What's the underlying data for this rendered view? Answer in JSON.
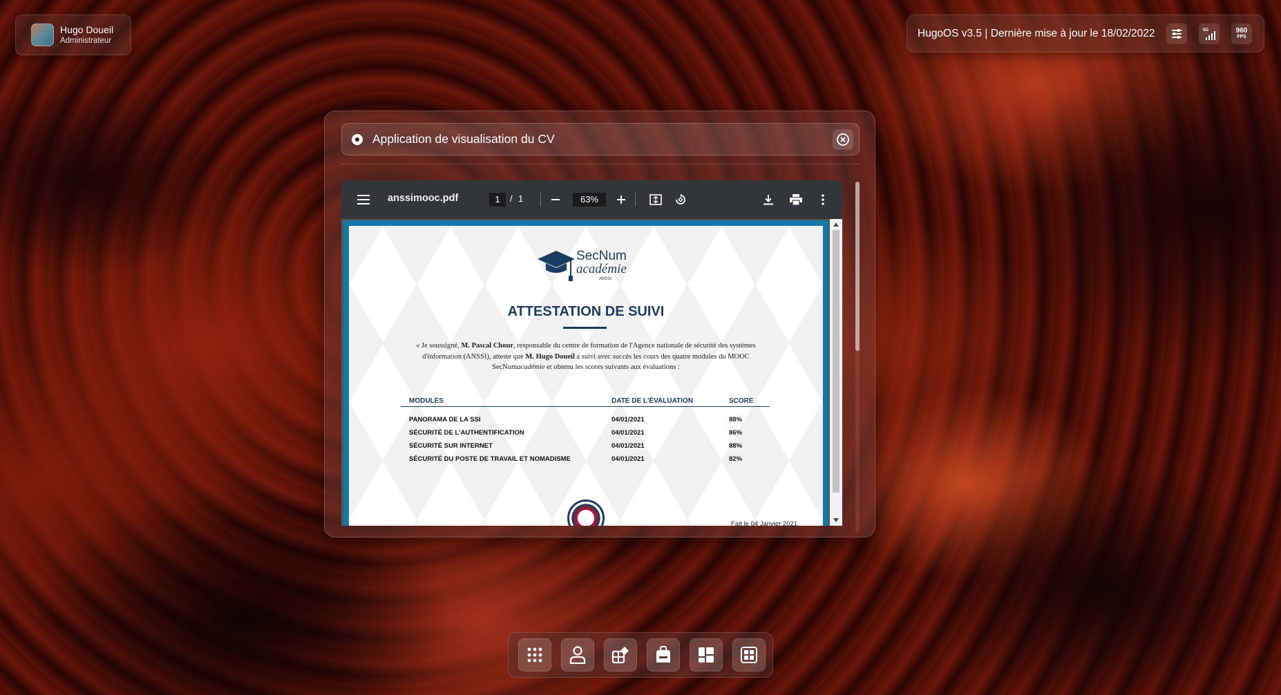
{
  "user": {
    "name": "Hugo Doueil",
    "role": "Administrateur"
  },
  "status": {
    "text": "HugoOS v3.5 | Dernière mise à jour le 18/02/2022",
    "network_label": "5G",
    "fps_value": "960",
    "fps_label": "FPS"
  },
  "app": {
    "title": "Application de visualisation du CV"
  },
  "pdf": {
    "filename": "anssimooc.pdf",
    "current_page": "1",
    "page_separator": "/",
    "total_pages": "1",
    "zoom": "63%"
  },
  "document": {
    "logo_line1": "SecNum",
    "logo_line2": "académie",
    "logo_line3": "ANSSI",
    "title": "ATTESTATION DE SUIVI",
    "body_1": "« Je soussigné, ",
    "body_name1": "M. Pascal Chour",
    "body_2": ", responsable du centre de formation de l'Agence nationale de sécurité des systèmes d'information (ANSSI), atteste que ",
    "body_name2": "M. Hugo Doueil",
    "body_3": " a suivi avec succès les cours des quatre modules du MOOC SecNum",
    "body_ital": "académie",
    "body_4": " et obtenu les scores suivants aux évaluations :",
    "table": {
      "headers": [
        "MODULES",
        "DATE DE L'ÉVALUATION",
        "SCORE"
      ],
      "rows": [
        [
          "PANORAMA DE LA SSI",
          "04/01/2021",
          "88%"
        ],
        [
          "SÉCURITÉ DE L'AUTHENTIFICATION",
          "04/01/2021",
          "86%"
        ],
        [
          "SÉCURITÉ SUR INTERNET",
          "04/01/2021",
          "88%"
        ],
        [
          "SÉCURITÉ DU POSTE DE TRAVAIL ET NOMADISME",
          "04/01/2021",
          "82%"
        ]
      ]
    },
    "fait_le": "Fait le 04 Janvier 2021"
  },
  "dock": {
    "items": [
      "apps-grid-icon",
      "profile-icon",
      "projects-icon",
      "experience-icon",
      "layout-icon",
      "widgets-icon"
    ]
  },
  "colors": {
    "accent_blue": "#1b3d62",
    "page_border": "#1479a6",
    "pdf_toolbar": "#323639"
  }
}
